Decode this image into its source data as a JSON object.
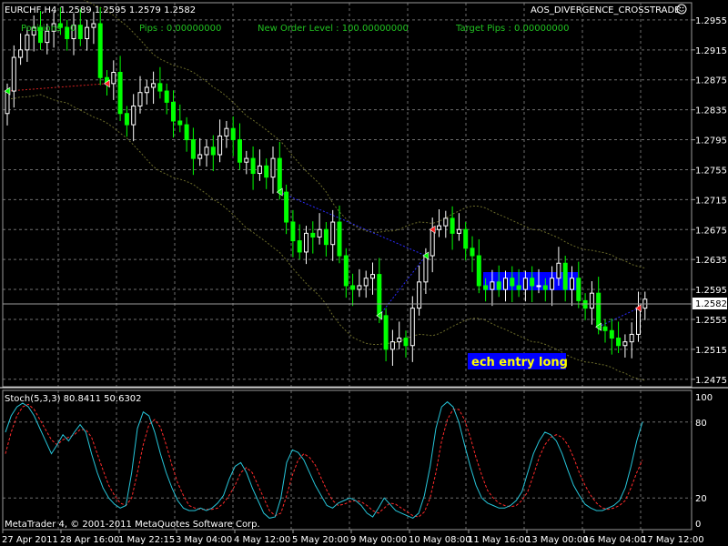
{
  "header": {
    "symbol_info": "EURCHF,H4  1.2589 1.2595 1.2579 1.2582",
    "indicator_name": "AOS_DIVERGENCE_CROSSTRADE",
    "positions": "Positions : 0",
    "pips": "Pips : 0.00000000",
    "new_order_level": "New Order Level : 100.00000000",
    "target_pips": "Target Pips : 0.00000000"
  },
  "annotation": {
    "entry_label": "ech entry long"
  },
  "stoch": {
    "label": "Stoch(5,3,3) 80.8411 50.6302",
    "levels": [
      "100",
      "80",
      "20",
      "0"
    ]
  },
  "footer": {
    "copyright": "MetaTrader 4, © 2001-2011 MetaQuotes Software Corp."
  },
  "colors": {
    "background": "#000000",
    "grid": "#6e6e6e",
    "bull": "#ffffff",
    "bear": "#00ff00",
    "band": "#6b6b2a",
    "entry_box": "#0000ff",
    "entry_text": "#ffff00",
    "stoch_main": "#26c6da",
    "stoch_signal": "#ff2a2a",
    "text_green": "#21c021"
  },
  "chart_data": {
    "type": "candlestick",
    "price_axis": {
      "ticks": [
        "1.2955",
        "1.2915",
        "1.2875",
        "1.2835",
        "1.2795",
        "1.2755",
        "1.2715",
        "1.2675",
        "1.2635",
        "1.2595",
        "1.2555",
        "1.2515",
        "1.2475"
      ],
      "current": "1.2582",
      "range": [
        1.2465,
        1.2978
      ]
    },
    "time_axis": {
      "labels": [
        "27 Apr 2011",
        "28 Apr 16:00",
        "1 May 22:15",
        "3 May 04:00",
        "4 May 12:00",
        "5 May 20:00",
        "9 May 00:00",
        "10 May 08:00",
        "11 May 16:00",
        "13 May 00:00",
        "16 May 04:00",
        "17 May 12:00"
      ]
    },
    "closes": [
      1.286,
      1.2905,
      1.2915,
      1.2935,
      1.2945,
      1.2925,
      1.294,
      1.295,
      1.2945,
      1.293,
      1.2948,
      1.293,
      1.2945,
      1.295,
      1.2878,
      1.287,
      1.2885,
      1.283,
      1.2815,
      1.284,
      1.2858,
      1.2865,
      1.287,
      1.286,
      1.2845,
      1.282,
      1.2815,
      1.2795,
      1.277,
      1.2775,
      1.2785,
      1.2775,
      1.28,
      1.281,
      1.2795,
      1.2765,
      1.277,
      1.275,
      1.276,
      1.2745,
      1.277,
      1.2725,
      1.2685,
      1.266,
      1.2645,
      1.267,
      1.2665,
      1.2675,
      1.2655,
      1.2685,
      1.264,
      1.26,
      1.2595,
      1.26,
      1.261,
      1.2615,
      1.256,
      1.2515,
      1.2525,
      1.253,
      1.252,
      1.257,
      1.2605,
      1.264,
      1.2675,
      1.268,
      1.269,
      1.267,
      1.2675,
      1.265,
      1.264,
      1.26,
      1.2595,
      1.2605,
      1.2595,
      1.261,
      1.26,
      1.2595,
      1.261,
      1.26,
      1.26,
      1.2595,
      1.261,
      1.263,
      1.2595,
      1.261,
      1.258,
      1.257,
      1.259,
      1.2545,
      1.254,
      1.253,
      1.252,
      1.2525,
      1.2535,
      1.257,
      1.2582
    ],
    "stoch_main": [
      72,
      85,
      92,
      95,
      92,
      85,
      75,
      65,
      55,
      62,
      70,
      65,
      72,
      78,
      72,
      55,
      40,
      28,
      20,
      15,
      12,
      14,
      40,
      75,
      88,
      85,
      72,
      55,
      40,
      28,
      18,
      12,
      10,
      10,
      12,
      10,
      12,
      16,
      22,
      35,
      45,
      48,
      40,
      28,
      18,
      8,
      4,
      5,
      20,
      48,
      58,
      56,
      50,
      40,
      30,
      22,
      14,
      12,
      16,
      18,
      20,
      18,
      14,
      8,
      5,
      12,
      20,
      15,
      10,
      8,
      6,
      4,
      8,
      22,
      45,
      75,
      92,
      96,
      92,
      80,
      62,
      45,
      30,
      20,
      16,
      14,
      12,
      12,
      14,
      18,
      25,
      40,
      55,
      65,
      72,
      70,
      65,
      55,
      42,
      30,
      22,
      15,
      12,
      10,
      10,
      12,
      14,
      18,
      28,
      45,
      65,
      80
    ],
    "stoch_signal": [
      55,
      72,
      85,
      92,
      94,
      90,
      82,
      74,
      66,
      62,
      66,
      68,
      70,
      74,
      74,
      68,
      55,
      42,
      30,
      22,
      16,
      14,
      20,
      40,
      62,
      78,
      82,
      76,
      62,
      46,
      32,
      22,
      14,
      12,
      11,
      11,
      11,
      12,
      16,
      22,
      30,
      40,
      44,
      40,
      30,
      20,
      10,
      6,
      8,
      22,
      38,
      50,
      55,
      52,
      46,
      36,
      26,
      18,
      14,
      15,
      17,
      18,
      17,
      14,
      10,
      8,
      12,
      16,
      15,
      12,
      9,
      6,
      5,
      9,
      20,
      40,
      65,
      82,
      90,
      90,
      82,
      68,
      52,
      38,
      26,
      20,
      16,
      14,
      13,
      14,
      18,
      25,
      38,
      52,
      62,
      68,
      70,
      68,
      62,
      52,
      40,
      30,
      22,
      16,
      12,
      11,
      12,
      14,
      18,
      28,
      40,
      50
    ]
  }
}
